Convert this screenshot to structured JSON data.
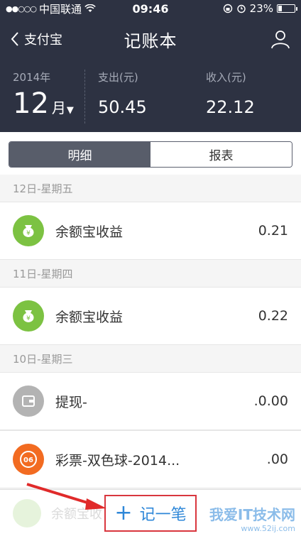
{
  "status_bar": {
    "signal": "●●○○○",
    "carrier": "中国联通",
    "time": "09:46",
    "battery_percent": "23%",
    "battery_level": 0.23
  },
  "nav": {
    "back_label": "支付宝",
    "title": "记账本"
  },
  "summary": {
    "year": "2014年",
    "month": "12",
    "month_unit": "月",
    "expense_label": "支出(元)",
    "expense_value": "50.45",
    "income_label": "收入(元)",
    "income_value": "22.12"
  },
  "tabs": [
    {
      "label": "明细",
      "active": true
    },
    {
      "label": "报表",
      "active": false
    }
  ],
  "days": [
    {
      "header": "12日-星期五",
      "items": [
        {
          "label": "余额宝收益",
          "amount": "0.21",
          "icon": "yuebao-icon",
          "color": "#7cc242"
        }
      ]
    },
    {
      "header": "11日-星期四",
      "items": [
        {
          "label": "余额宝收益",
          "amount": "0.22",
          "icon": "yuebao-icon",
          "color": "#7cc242"
        }
      ]
    },
    {
      "header": "10日-星期三",
      "items": [
        {
          "label": "提现-",
          "amount": ".0.00",
          "icon": "wallet-icon",
          "color": "#b3b3b3"
        },
        {
          "label": "彩票-双色球-2014...",
          "amount": ".00",
          "icon": "lottery-icon",
          "color": "#f26b21"
        }
      ]
    }
  ],
  "add_button": {
    "label": "记一笔"
  },
  "faded_row_label": "余额宝收",
  "watermark": {
    "line1": "我爱IT技术网",
    "line2": "www.52ij.com"
  }
}
